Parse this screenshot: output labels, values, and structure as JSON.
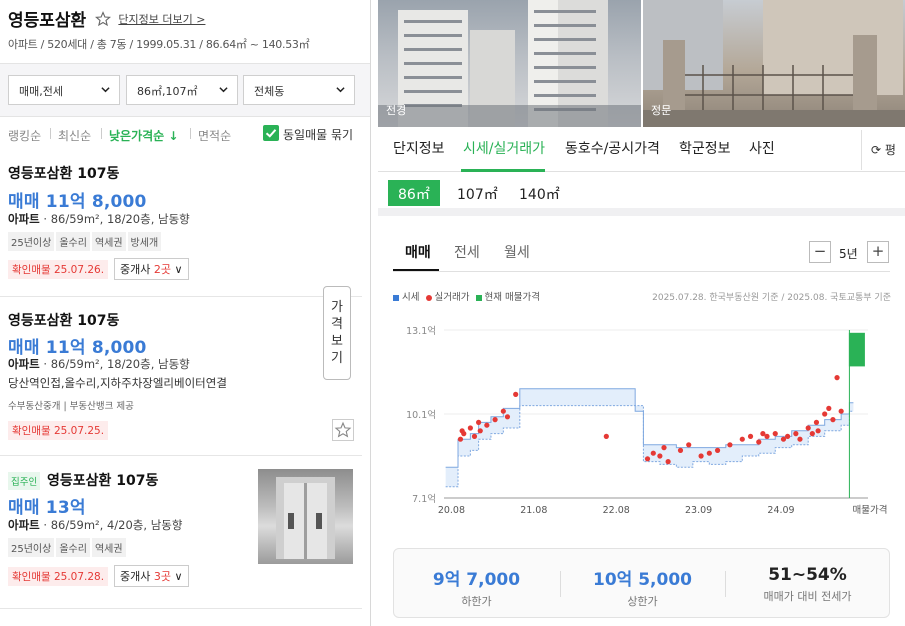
{
  "header": {
    "title": "영등포삼환",
    "more_link": "단지정보 더보기 >",
    "subtitle": "아파트 / 520세대 / 총 7동 / 1999.05.31 / 86.64㎡ ~ 140.53㎡"
  },
  "filters": {
    "trade_type": "매매,전세",
    "area": "86㎡,107㎡",
    "dong": "전체동"
  },
  "sort": {
    "items": [
      "랭킹순",
      "최신순",
      "낮은가격순 ↓",
      "면적순"
    ],
    "active": "낮은가격순 ↓",
    "same_listing_label": "동일매물 묶기"
  },
  "price_view_button": "가격보기",
  "listings": [
    {
      "name": "영등포삼환 107동",
      "price": "매매 11억 8,000",
      "spec_type": "아파트",
      "spec": "86/59m², 18/20층, 남동향",
      "tags": [
        "25년이상",
        "올수리",
        "역세권",
        "방세개"
      ],
      "confirm": "확인매물 25.07.26.",
      "agent_prefix": "중개사 ",
      "agent_count": "2곳",
      "agent_suffix": " ∨"
    },
    {
      "name": "영등포삼환 107동",
      "price": "매매 11억 8,000",
      "spec_type": "아파트",
      "spec": "86/59m², 18/20층, 남동향",
      "desc": "당산역인접,올수리,지하주차장엘리베이터연결",
      "provider": "수부동산중개 | 부동산뱅크 제공",
      "confirm": "확인매물 25.07.25."
    },
    {
      "owner_badge": "집주인",
      "name": "영등포삼환 107동",
      "price": "매매 13억",
      "spec_type": "아파트",
      "spec": "86/59m², 4/20층, 남동향",
      "tags": [
        "25년이상",
        "올수리",
        "역세권"
      ],
      "confirm": "확인매물 25.07.28.",
      "agent_prefix": "중개사 ",
      "agent_count": "3곳",
      "agent_suffix": " ∨"
    }
  ],
  "photos": [
    {
      "label": "전경"
    },
    {
      "label": "정문"
    }
  ],
  "tabs": [
    "단지정보",
    "시세/실거래가",
    "동호수/공시가격",
    "학군정보",
    "사진"
  ],
  "active_tab": "시세/실거래가",
  "refresh_label": "⟳ 평",
  "sizes": [
    "86㎡",
    "107㎡",
    "140㎡"
  ],
  "active_size": "86㎡",
  "subtabs": [
    "매매",
    "전세",
    "월세"
  ],
  "year_range": {
    "minus": "−",
    "label": "5년",
    "plus": "+"
  },
  "legend": {
    "items": [
      {
        "label": "시세",
        "color": "#3a7bd5",
        "shape": "square"
      },
      {
        "label": "실거래가",
        "color": "#e53935",
        "shape": "dot"
      },
      {
        "label": "현재 매물가격",
        "color": "#2ab256",
        "shape": "square"
      }
    ],
    "note": "2025.07.28. 한국부동산원 기준 / 2025.08. 국토교통부 기준"
  },
  "chart_data": {
    "type": "line",
    "title": "",
    "ylabel": "",
    "xlabel": "",
    "y_unit": "억",
    "ylim": [
      7.1,
      13.1
    ],
    "y_ticks": [
      "13.1억",
      "10.1억",
      "7.1억"
    ],
    "x_ticks": [
      "20.08",
      "21.08",
      "22.08",
      "23.09",
      "24.09",
      "매물가격"
    ],
    "xlim": [
      2020.58,
      2025.58
    ],
    "series": [
      {
        "name": "시세",
        "kind": "band",
        "color": "#7fa8e0",
        "x": [
          2020.6,
          2020.75,
          2020.9,
          2021.0,
          2021.15,
          2021.3,
          2021.5,
          2021.7,
          2021.9,
          2022.1,
          2022.3,
          2022.5,
          2022.7,
          2022.9,
          2023.0,
          2023.2,
          2023.4,
          2023.6,
          2023.8,
          2024.0,
          2024.2,
          2024.4,
          2024.6,
          2024.8,
          2025.0,
          2025.2,
          2025.4,
          2025.5
        ],
        "lower": [
          7.5,
          8.6,
          8.8,
          9.2,
          9.4,
          9.6,
          10.4,
          10.4,
          10.4,
          10.4,
          10.4,
          10.4,
          10.4,
          10.4,
          8.4,
          8.3,
          8.2,
          8.4,
          8.3,
          8.4,
          8.6,
          8.7,
          8.9,
          9.0,
          9.3,
          9.5,
          9.7,
          10.2
        ],
        "upper": [
          8.2,
          9.2,
          9.4,
          9.8,
          10.0,
          10.3,
          11.0,
          11.0,
          11.0,
          11.0,
          11.0,
          11.0,
          11.0,
          10.2,
          9.0,
          9.0,
          8.9,
          8.9,
          8.9,
          9.0,
          9.0,
          9.2,
          9.3,
          9.5,
          9.7,
          9.9,
          10.1,
          10.5
        ]
      },
      {
        "name": "실거래가",
        "kind": "scatter",
        "color": "#e53935",
        "x": [
          2020.78,
          2020.8,
          2020.82,
          2020.9,
          2020.95,
          2021.0,
          2021.02,
          2021.1,
          2021.2,
          2021.3,
          2021.35,
          2021.45,
          2022.55,
          2023.05,
          2023.12,
          2023.2,
          2023.25,
          2023.3,
          2023.45,
          2023.55,
          2023.7,
          2023.8,
          2023.9,
          2024.05,
          2024.2,
          2024.3,
          2024.4,
          2024.45,
          2024.5,
          2024.6,
          2024.7,
          2024.75,
          2024.85,
          2024.9,
          2025.0,
          2025.05,
          2025.1,
          2025.12,
          2025.2,
          2025.25,
          2025.3,
          2025.35,
          2025.4
        ],
        "y": [
          9.2,
          9.5,
          9.4,
          9.6,
          9.3,
          9.8,
          9.5,
          9.7,
          9.9,
          10.2,
          10.0,
          10.8,
          9.3,
          8.5,
          8.7,
          8.6,
          8.9,
          8.4,
          8.8,
          9.0,
          8.6,
          8.7,
          8.8,
          9.0,
          9.2,
          9.3,
          9.1,
          9.4,
          9.3,
          9.4,
          9.2,
          9.3,
          9.4,
          9.2,
          9.6,
          9.4,
          9.8,
          9.5,
          10.1,
          10.3,
          9.9,
          11.4,
          10.2
        ]
      },
      {
        "name": "현재 매물가격",
        "kind": "bar",
        "color": "#2ab256",
        "x": 2025.5,
        "low": 11.8,
        "high": 13.0
      }
    ]
  },
  "summary": [
    {
      "value": "9억 7,000",
      "label": "하한가"
    },
    {
      "value": "10억 5,000",
      "label": "상한가"
    },
    {
      "value": "51~54%",
      "label": "매매가 대비 전세가"
    }
  ]
}
